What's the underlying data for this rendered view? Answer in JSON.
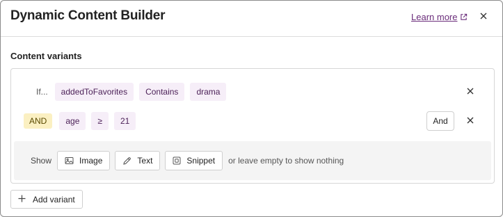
{
  "header": {
    "title": "Dynamic Content Builder",
    "learn_more": "Learn more",
    "learn_more_icon": "external-link-icon",
    "close_icon": "close-icon"
  },
  "section": {
    "title": "Content variants"
  },
  "variant": {
    "row1": {
      "prefix": "If...",
      "field": "addedToFavorites",
      "operator": "Contains",
      "value": "drama"
    },
    "row2": {
      "connector": "AND",
      "field": "age",
      "operator": "≥",
      "value": "21",
      "and_button": "And"
    },
    "show": {
      "label": "Show",
      "buttons": [
        {
          "label": "Image",
          "icon": "image-icon"
        },
        {
          "label": "Text",
          "icon": "pencil-icon"
        },
        {
          "label": "Snippet",
          "icon": "snippet-icon"
        }
      ],
      "empty_note": "or leave empty to show nothing"
    }
  },
  "footer": {
    "add_variant": "Add variant",
    "add_icon": "plus-icon"
  },
  "colors": {
    "chip_bg": "#f6eef8",
    "chip_text": "#4c2158",
    "and_bg": "#fbf0c2",
    "link": "#6a2c7a"
  }
}
